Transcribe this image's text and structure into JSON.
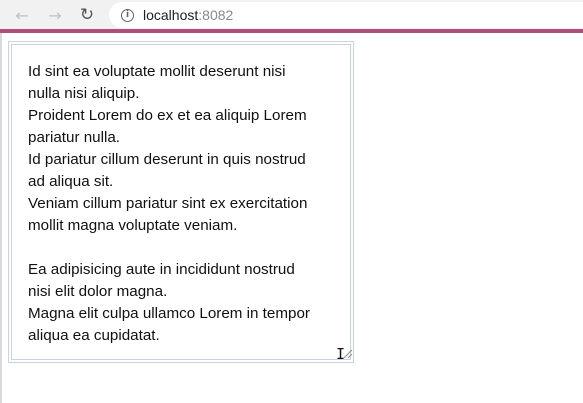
{
  "browser": {
    "back_icon": "arrow-left-icon",
    "forward_icon": "arrow-right-icon",
    "reload_icon": "reload-icon",
    "info_icon": "info-circle-icon",
    "url_host": "localhost",
    "url_port": ":8082",
    "accent_color": "#b04e7a"
  },
  "textarea": {
    "lines": [
      "Id sint ea voluptate mollit deserunt nisi",
      "nulla nisi aliquip.",
      "Proident Lorem do ex et ea aliquip Lorem",
      "pariatur nulla.",
      "Id pariatur cillum deserunt in quis nostrud",
      "ad aliqua sit.",
      "Veniam cillum pariatur sint ex exercitation",
      "mollit magna voluptate veniam.",
      "",
      "Ea adipisicing aute in incididunt nostrud",
      "nisi elit dolor magna.",
      "Magna elit culpa ullamco Lorem in tempor",
      "aliqua ea cupidatat."
    ]
  }
}
